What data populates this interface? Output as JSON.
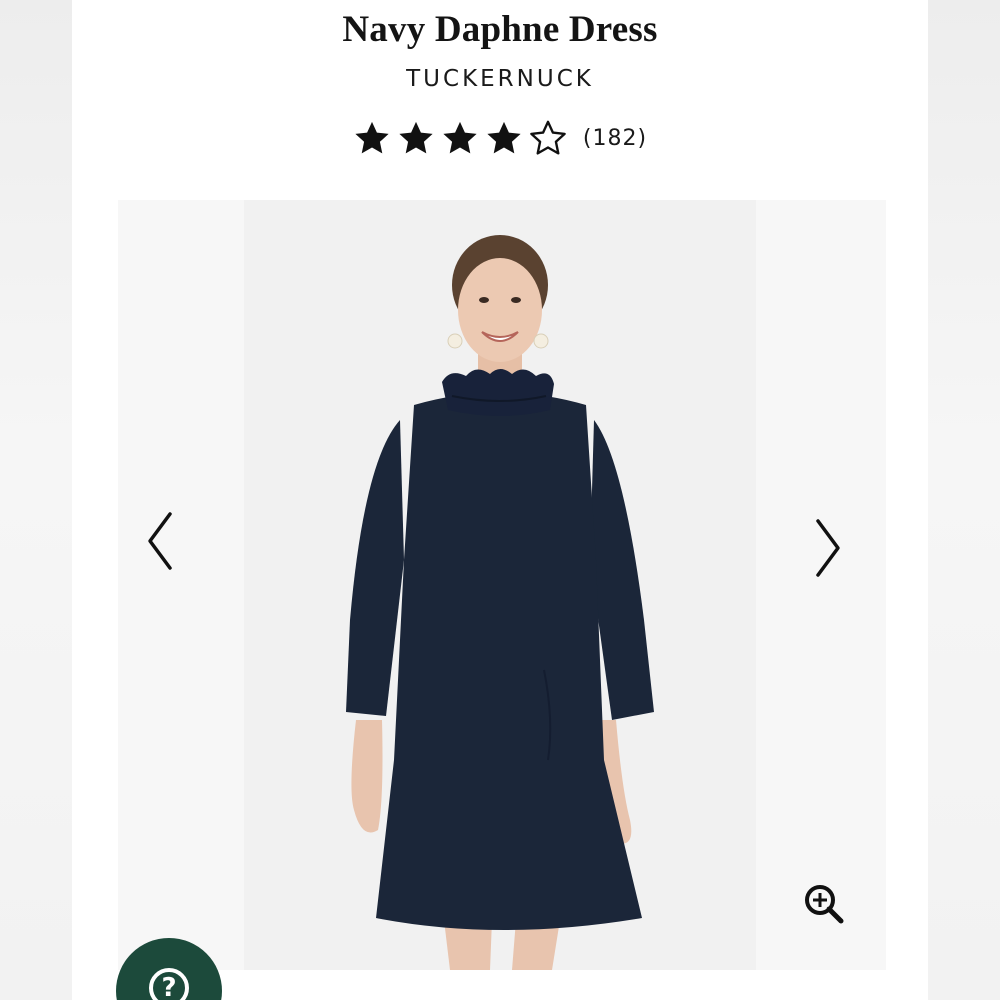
{
  "product": {
    "title": "Navy Daphne Dress",
    "brand": "TUCKERNUCK",
    "rating": 4,
    "rating_max": 5,
    "review_count": "(182)"
  },
  "icons": {
    "prev": "chevron-left-icon",
    "next": "chevron-right-icon",
    "zoom": "zoom-in-icon",
    "help": "question-mark-icon",
    "star_filled": "star-filled-icon",
    "star_empty": "star-outline-icon"
  },
  "help_button": {
    "glyph": "?"
  },
  "colors": {
    "dress": "#1b2639",
    "help_button": "#1c4a3b",
    "text": "#141414"
  }
}
